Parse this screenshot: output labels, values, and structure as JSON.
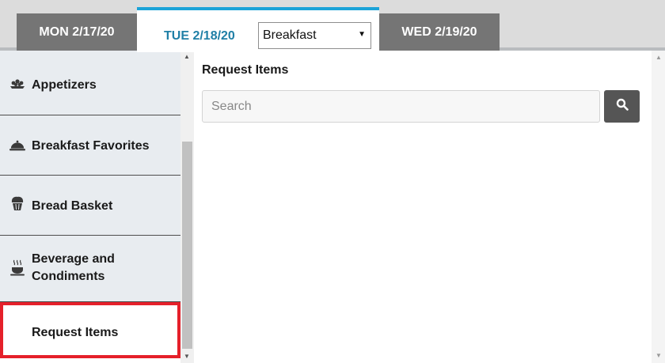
{
  "tabs": {
    "prev_day": "MON 2/17/20",
    "current_day": "TUE 2/18/20",
    "next_day": "WED 2/19/20"
  },
  "meal_select": {
    "value": "Breakfast",
    "arrow": "▼"
  },
  "categories": [
    {
      "label": "Appetizers",
      "icon": "appetizer-tray-icon"
    },
    {
      "label": "Breakfast Favorites",
      "icon": "food-cloche-icon"
    },
    {
      "label": "Bread Basket",
      "icon": "muffin-icon"
    },
    {
      "label": "Beverage and Condiments",
      "icon": "hot-beverage-icon"
    },
    {
      "label": "Request Items",
      "icon": "",
      "selected": true
    }
  ],
  "main": {
    "title": "Request Items",
    "search_placeholder": "Search"
  },
  "colors": {
    "accent": "#1ba3d8",
    "active_tab_text": "#1f7fa6",
    "selected_border": "#e5202a",
    "inactive_tab": "#757575",
    "search_button": "#555555"
  }
}
